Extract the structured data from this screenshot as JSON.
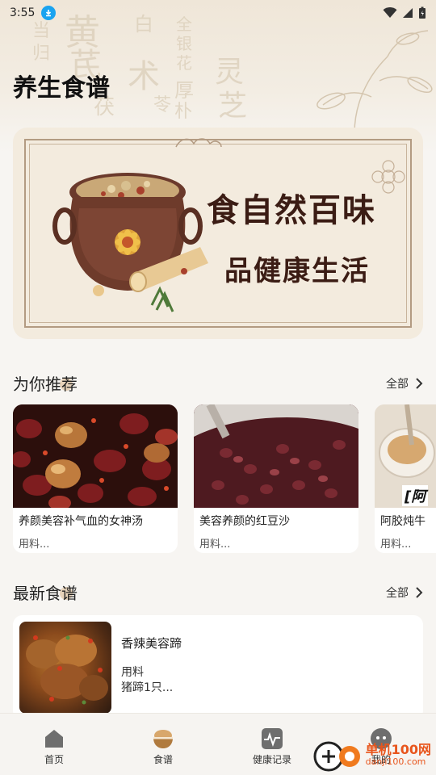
{
  "status_bar": {
    "time": "3:55"
  },
  "header": {
    "title": "养生食谱",
    "background_glyphs": [
      "黄",
      "芪",
      "当",
      "归",
      "白",
      "术",
      "茯",
      "苓",
      "全",
      "银",
      "花",
      "厚",
      "朴",
      "灵",
      "芝"
    ]
  },
  "banner": {
    "line1": "食自然百味",
    "line2": "品健康生活"
  },
  "recommend": {
    "title": "为你推荐",
    "all_label": "全部",
    "items": [
      {
        "title": "养颜美容补气血的女神汤",
        "subtitle": "用料..."
      },
      {
        "title": "美容养颜的红豆沙",
        "subtitle": "用料..."
      },
      {
        "title": "阿胶炖牛",
        "subtitle": "用料...",
        "image_text": "[阿"
      }
    ]
  },
  "latest": {
    "title": "最新食谱",
    "all_label": "全部",
    "item": {
      "title": "香辣美容蹄",
      "label": "用料",
      "detail": "猪蹄1只..."
    }
  },
  "bottom_nav": {
    "items": [
      {
        "label": "首页",
        "icon": "home-icon"
      },
      {
        "label": "食谱",
        "icon": "bowl-icon"
      },
      {
        "label": "健康记录",
        "icon": "pulse-icon"
      },
      {
        "label": "我的",
        "icon": "chat-face-icon"
      }
    ]
  },
  "watermark": {
    "brand": "单机100网",
    "url": "danji100.com"
  },
  "colors": {
    "accent_orange": "#e8551c",
    "download_badge": "#1aa3f0",
    "background": "#f7f5f2"
  }
}
